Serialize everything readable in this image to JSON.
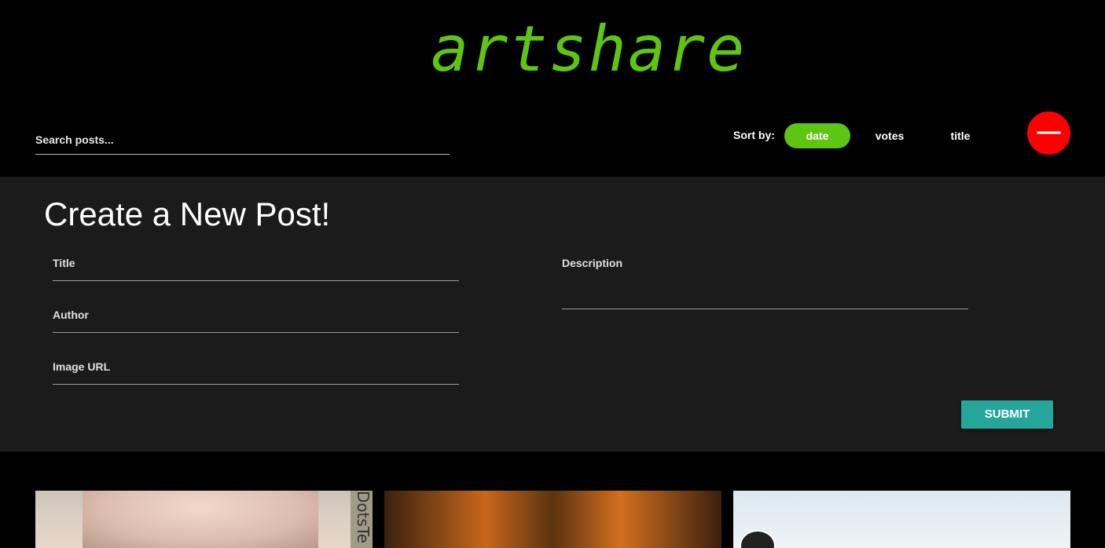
{
  "app": {
    "logo": "artshare"
  },
  "toolbar": {
    "search_placeholder": "Search posts...",
    "sort_label": "Sort by:",
    "sort_options": [
      "date",
      "votes",
      "title"
    ],
    "sort_selected": "date",
    "fab_symbol": "—",
    "accent_color": "#5ec513",
    "fab_color": "#ff0000"
  },
  "new_post": {
    "heading": "Create a New Post!",
    "fields": {
      "title": "Title",
      "author": "Author",
      "image_url": "Image URL",
      "description": "Description"
    },
    "submit_label": "SUBMIT",
    "submit_color": "#26a69a"
  },
  "gallery": {
    "card_1_watermark": "DotsTe"
  }
}
